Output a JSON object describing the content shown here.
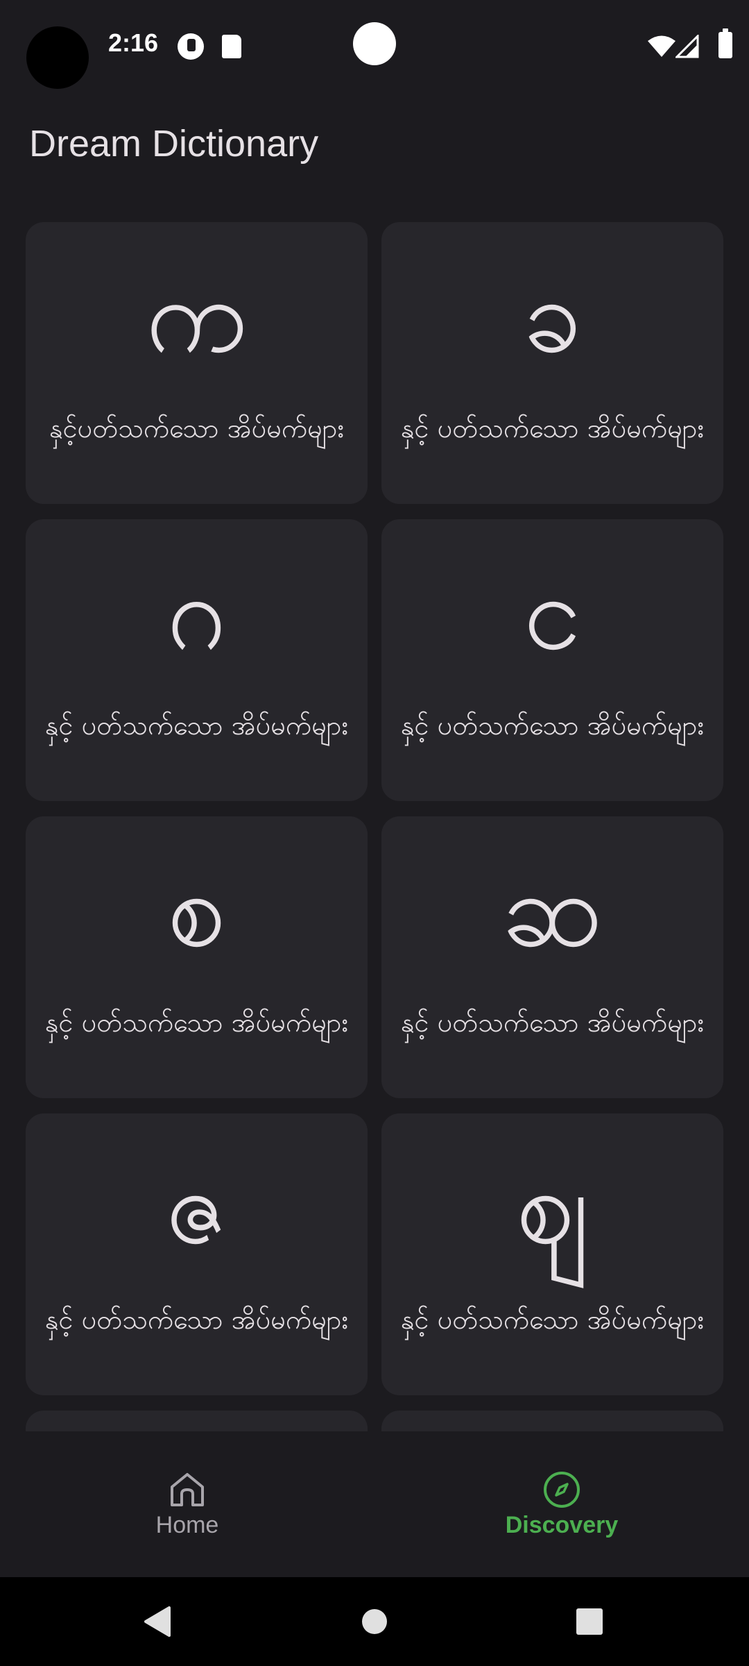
{
  "status_bar": {
    "time": "2:16",
    "icons": [
      "camera-cutout",
      "app-notification-icon",
      "sd-card-icon",
      "wifi-icon",
      "cellular-signal-icon",
      "battery-icon"
    ]
  },
  "app_bar": {
    "title": "Dream Dictionary"
  },
  "grid": {
    "items": [
      {
        "letter": "က",
        "caption": "နှင့်ပတ်သက်သော အိပ်မက်များ"
      },
      {
        "letter": "ခ",
        "caption": "နှင့် ပတ်သက်သော အိပ်မက်များ"
      },
      {
        "letter": "ဂ",
        "caption": "နှင့် ပတ်သက်သော အိပ်မက်များ"
      },
      {
        "letter": "င",
        "caption": "နှင့် ပတ်သက်သော အိပ်မက်များ"
      },
      {
        "letter": "စ",
        "caption": "နှင့် ပတ်သက်သော အိပ်မက်များ"
      },
      {
        "letter": "ဆ",
        "caption": "နှင့် ပတ်သက်သော အိပ်မက်များ"
      },
      {
        "letter": "ဇ",
        "caption": "နှင့် ပတ်သက်သော အိပ်မက်များ"
      },
      {
        "letter": "ဈ",
        "caption": "နှင့် ပတ်သက်သော အိပ်မက်များ"
      },
      {
        "letter": "",
        "caption": ""
      },
      {
        "letter": "",
        "caption": ""
      }
    ]
  },
  "bottom_nav": {
    "items": [
      {
        "label": "Home",
        "icon": "home-icon",
        "selected": false
      },
      {
        "label": "Discovery",
        "icon": "compass-icon",
        "selected": true
      }
    ],
    "active_color": "#4caf50",
    "inactive_color": "#a8a5ab"
  },
  "system_nav": {
    "buttons": [
      "back-icon",
      "home-circle-icon",
      "recents-icon"
    ]
  },
  "colors": {
    "background": "#1c1b1f",
    "card": "#27262b",
    "text": "#e6e1e5"
  }
}
